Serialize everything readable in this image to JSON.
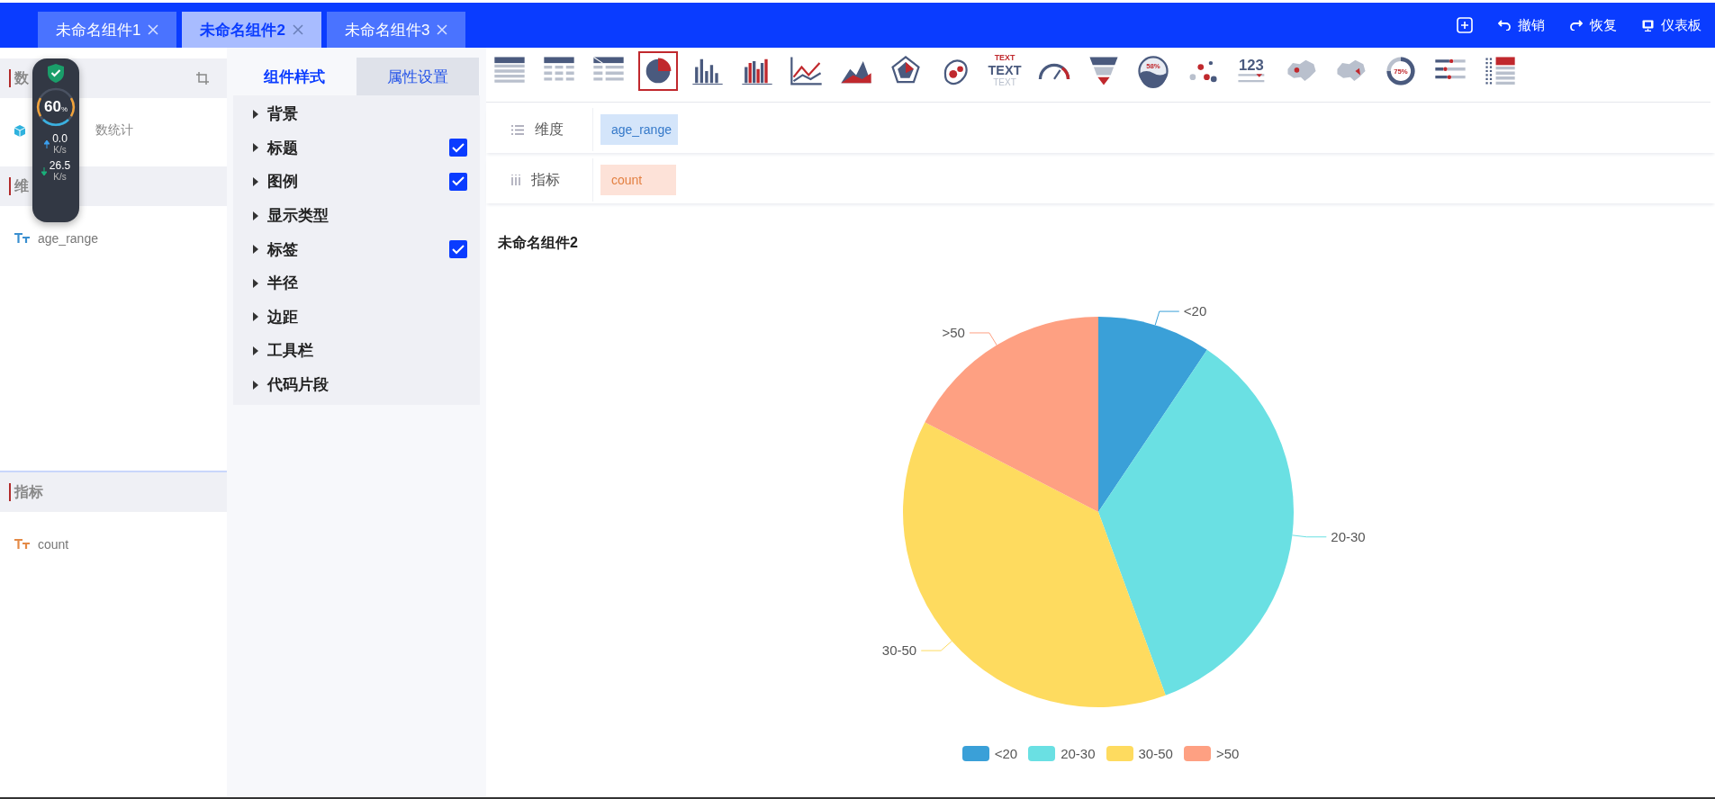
{
  "tabs": [
    {
      "label": "未命名组件1",
      "selected": false
    },
    {
      "label": "未命名组件2",
      "selected": true
    },
    {
      "label": "未命名组件3",
      "selected": false
    }
  ],
  "header_actions": [
    {
      "kind": "add"
    },
    {
      "kind": "undo",
      "label": "撤销"
    },
    {
      "kind": "redo",
      "label": "恢复"
    },
    {
      "kind": "dashboard",
      "label": "仪表板"
    }
  ],
  "sidebar": {
    "sections": [
      {
        "title": "数",
        "items": [
          {
            "kind": "dataset",
            "label": "数统计"
          }
        ]
      },
      {
        "title": "维",
        "items": [
          {
            "kind": "dimension",
            "label": "age_range"
          }
        ]
      },
      {
        "title": "指标",
        "items": [
          {
            "kind": "measure",
            "label": "count"
          }
        ]
      }
    ]
  },
  "net_monitor": {
    "percent": "60",
    "unit": "%",
    "upload": "0.0",
    "upload_unit": "K/s",
    "download": "26.5",
    "download_unit": "K/s"
  },
  "style_panel": {
    "tabs": [
      {
        "label": "组件样式",
        "selected": true
      },
      {
        "label": "属性设置",
        "selected": false
      }
    ],
    "items": [
      {
        "kind": "plain",
        "label": "背景"
      },
      {
        "kind": "check",
        "label": "标题",
        "checked": true
      },
      {
        "kind": "check",
        "label": "图例",
        "checked": true
      },
      {
        "kind": "plain",
        "label": "显示类型"
      },
      {
        "kind": "check",
        "label": "标签",
        "checked": true
      },
      {
        "kind": "plain",
        "label": "半径"
      },
      {
        "kind": "plain",
        "label": "边距"
      },
      {
        "kind": "plain",
        "label": "工具栏"
      },
      {
        "kind": "plain",
        "label": "代码片段"
      }
    ]
  },
  "chart_types": [
    {
      "kind": "table",
      "selected": false
    },
    {
      "kind": "table-group",
      "selected": false
    },
    {
      "kind": "pivot",
      "selected": false
    },
    {
      "kind": "pie",
      "selected": true
    },
    {
      "kind": "bar",
      "selected": false
    },
    {
      "kind": "bar-mixed",
      "selected": false
    },
    {
      "kind": "line",
      "selected": false
    },
    {
      "kind": "area",
      "selected": false
    },
    {
      "kind": "radar",
      "selected": false
    },
    {
      "kind": "blob",
      "selected": false
    },
    {
      "kind": "text",
      "selected": false,
      "top_label": "TEXT",
      "label": "TEXT",
      "sublabel": "TEXT"
    },
    {
      "kind": "gauge",
      "selected": false
    },
    {
      "kind": "funnel",
      "selected": false
    },
    {
      "kind": "liquid",
      "selected": false,
      "label": "58%"
    },
    {
      "kind": "scatter",
      "selected": false
    },
    {
      "kind": "number",
      "selected": false,
      "label": "123"
    },
    {
      "kind": "map",
      "selected": false
    },
    {
      "kind": "map-pin",
      "selected": false
    },
    {
      "kind": "progress",
      "selected": false,
      "label": "75%"
    },
    {
      "kind": "bar-list",
      "selected": false
    },
    {
      "kind": "heatmap",
      "selected": false
    }
  ],
  "fields": [
    {
      "kind": "dimension",
      "label": "维度",
      "value": "age_range"
    },
    {
      "kind": "measure",
      "label": "指标",
      "value": "count"
    }
  ],
  "chart": {
    "title": "未命名组件2",
    "chart_data": {
      "type": "pie",
      "categories": [
        "<20",
        "20-30",
        "30-50",
        ">50"
      ],
      "values": [
        9.4,
        35,
        38.2,
        17.4
      ],
      "colors": [
        "#3aa0d8",
        "#6ae0e3",
        "#fedb5f",
        "#fea082"
      ]
    },
    "legend": [
      {
        "label": "<20",
        "color": "#3aa0d8"
      },
      {
        "label": "20-30",
        "color": "#6ae0e3"
      },
      {
        "label": "30-50",
        "color": "#fedb5f"
      },
      {
        "label": ">50",
        "color": "#fea082"
      }
    ]
  }
}
